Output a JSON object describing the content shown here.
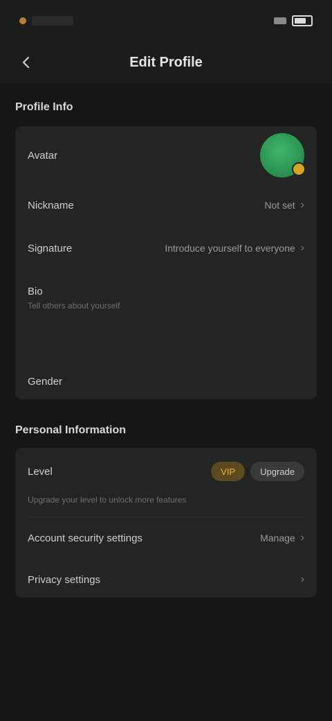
{
  "status": {
    "time": ""
  },
  "app_bar": {
    "title": "Edit Profile"
  },
  "section1": {
    "title": "Profile Info",
    "rows": {
      "avatar_label": "Avatar",
      "nickname_label": "Nickname",
      "nickname_value": "Not set",
      "signature_label": "Signature",
      "signature_value": "Introduce yourself to everyone",
      "bio_label": "Bio",
      "bio_hint": "Tell others about yourself",
      "gender_label": "Gender"
    }
  },
  "section2": {
    "title": "Personal Information",
    "rows": {
      "level_label": "Level",
      "level_chip": "VIP",
      "level_chip2": "Upgrade",
      "level_hint": "Upgrade your level to unlock more features",
      "account_label": "Account security settings",
      "account_value": "Manage",
      "privacy_label": "Privacy settings"
    }
  },
  "icons": {
    "back": "back-arrow-icon",
    "chevron": "chevron-right-icon"
  },
  "colors": {
    "background": "#161616",
    "card": "#242424",
    "accent_green": "#3fb66a",
    "accent_gold": "#d8a522"
  }
}
